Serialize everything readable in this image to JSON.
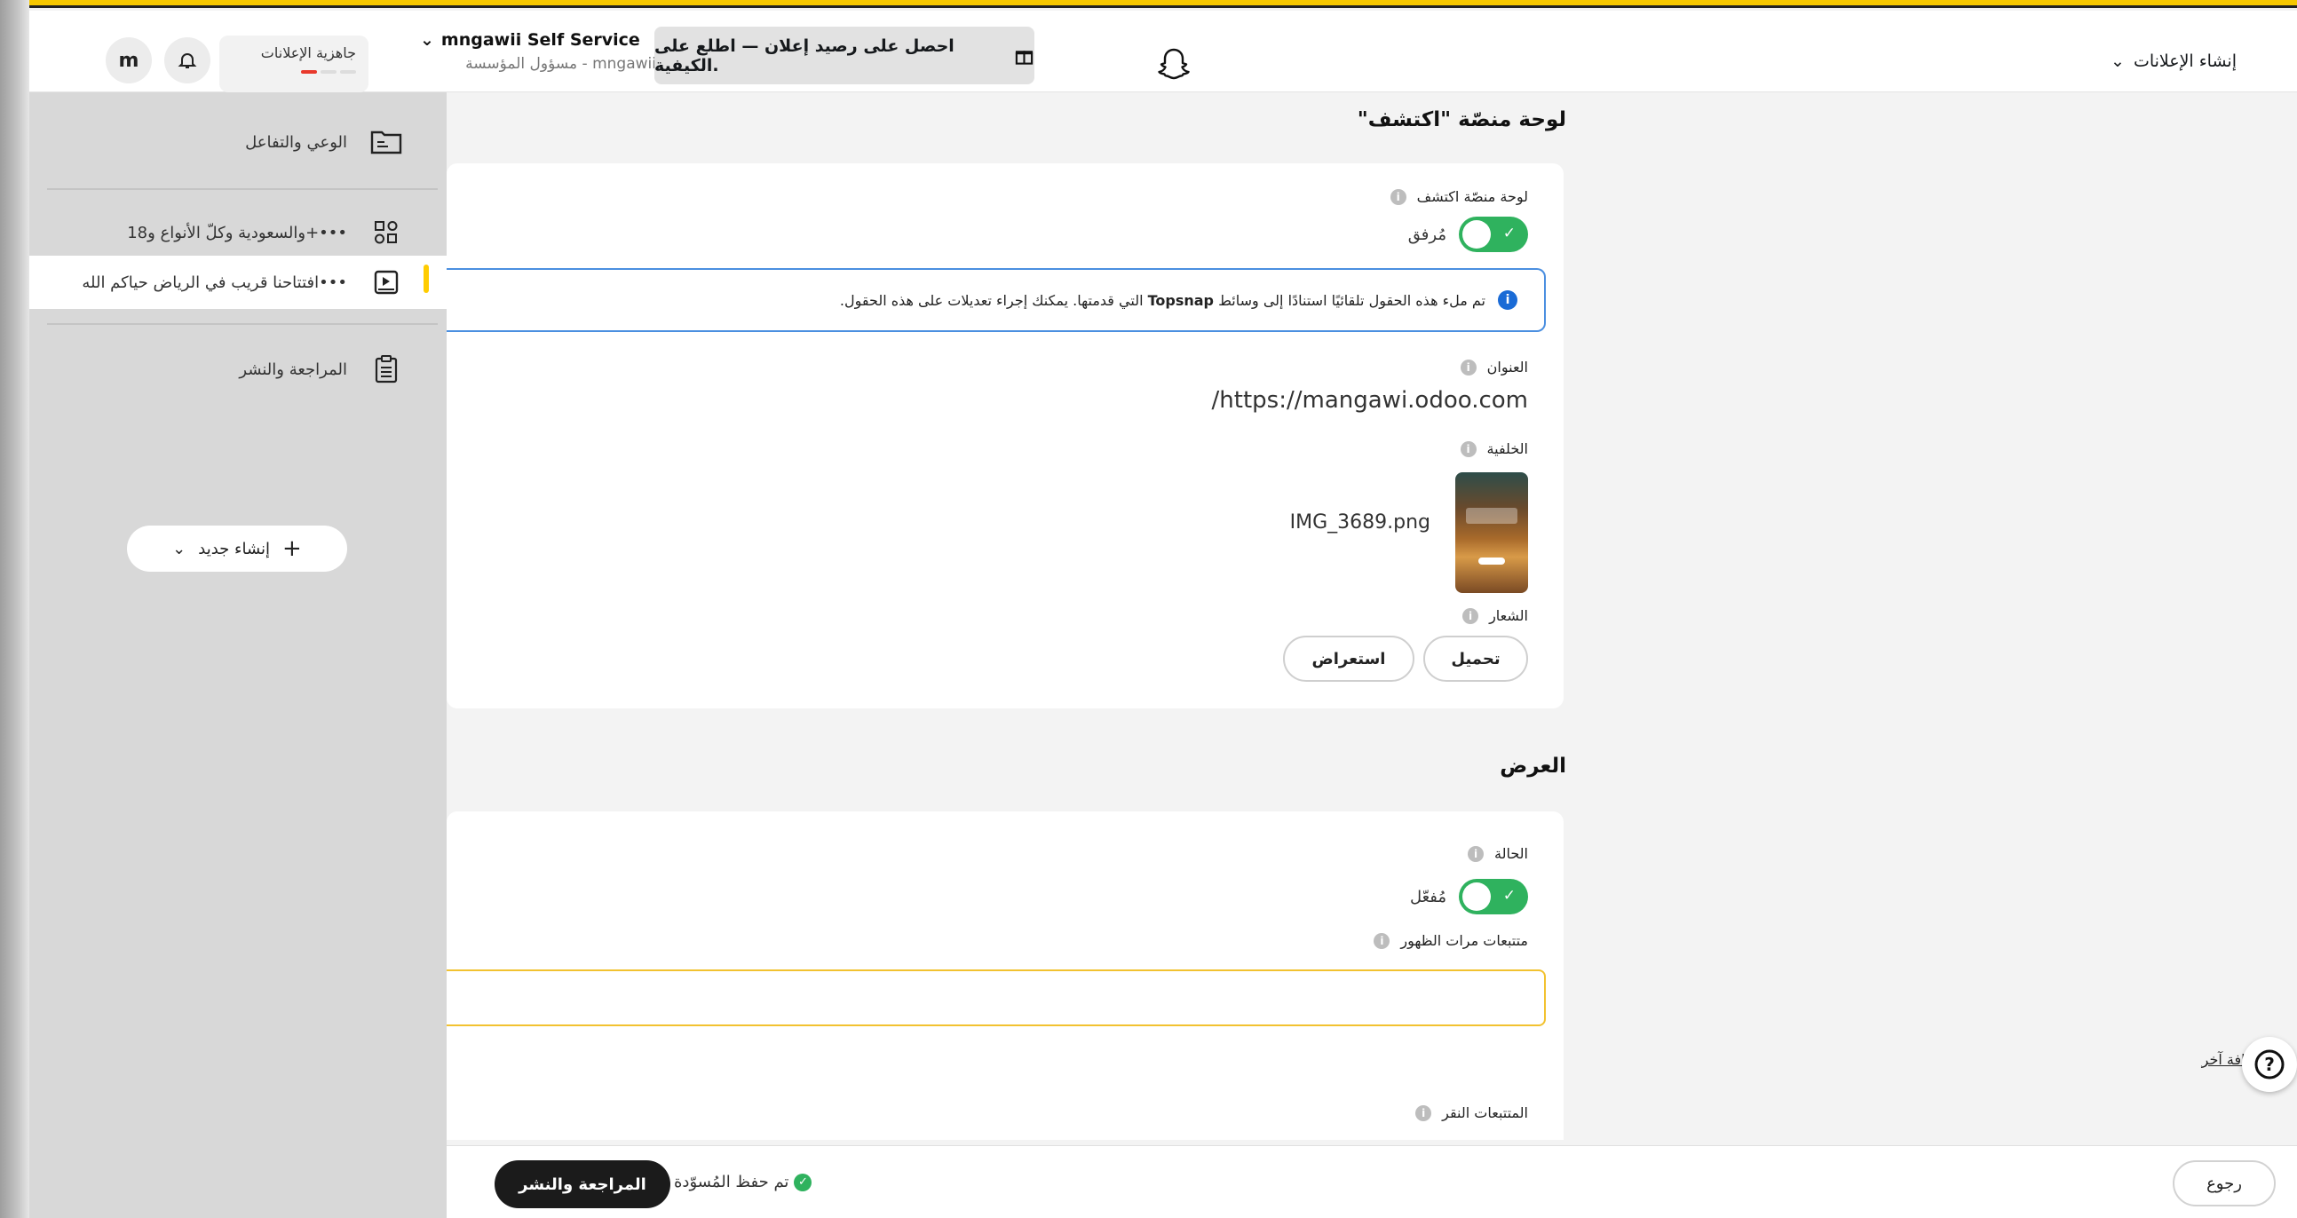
{
  "header": {
    "avatar_letter": "m",
    "readiness_label": "جاهزية الإعلانات",
    "account_name": "mngawii Self Service",
    "account_sub": "مسؤول المؤسسة - mngawii",
    "promo_text": "احصل على رصيد إعلان — اطلع على الكيفية.",
    "create_menu_label": "إنشاء الإعلانات"
  },
  "sidebar": {
    "items": [
      {
        "label": "الوعي والتفاعل",
        "icon": "folder-icon"
      },
      {
        "label": "والسعودية وكلّ الأنواع و18+•••",
        "icon": "ad-squad-icon"
      },
      {
        "label": "افتتاحنا قريب في الرياض حياكم الله•••",
        "icon": "ad-media-icon"
      },
      {
        "label": "المراجعة والنشر",
        "icon": "clipboard-icon"
      }
    ],
    "new_button_label": "إنشاء جديد"
  },
  "discover": {
    "section_title": "لوحة منصّة \"اكتشف\"",
    "tile_label": "لوحة منصّة اكتشف",
    "tile_state": "مُرفق",
    "notice_prefix": "تم ملء هذه الحقول تلقائيًا استنادًا إلى وسائط ",
    "notice_bold": "Topsnap",
    "notice_suffix": " التي قدمتها. يمكنك إجراء تعديلات على هذه الحقول.",
    "headline_label": "العنوان",
    "headline_value": "/https://mangawi.odoo.com",
    "background_label": "الخلفية",
    "background_file": "IMG_3689.png",
    "logo_label": "الشعار",
    "upload_label": "تحميل",
    "browse_label": "استعراض"
  },
  "display": {
    "section_title": "العرض",
    "status_label": "الحالة",
    "status_state": "مُفعّل",
    "impression_label": "متتبعات مرات الظهور",
    "add_another": "إضافة آخر",
    "click_label": "المتتبعات النقر"
  },
  "footer": {
    "publish_label": "المراجعة والنشر",
    "saved_text": "تم حفظ المُسوّدة",
    "back_label": "رجوع"
  },
  "colors": {
    "accent_yellow": "#f7c800",
    "toggle_green": "#2fb25e",
    "info_blue": "#1a6bd6"
  }
}
